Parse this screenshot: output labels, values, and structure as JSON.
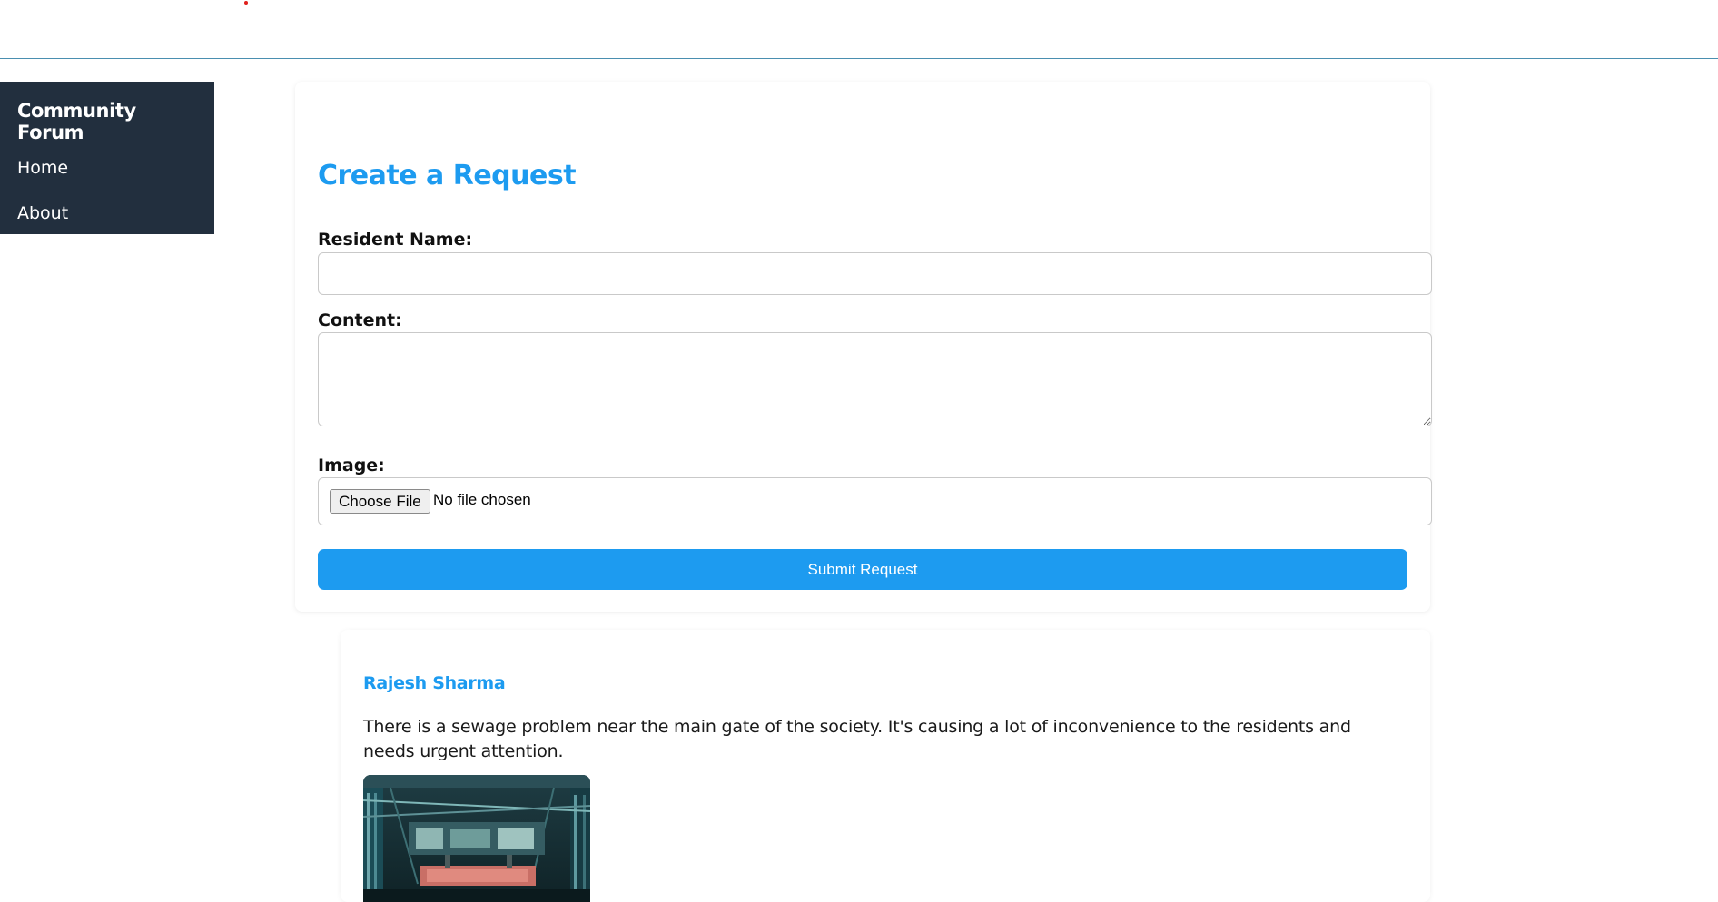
{
  "sidebar": {
    "title": "Community Forum",
    "items": [
      {
        "label": "Home"
      },
      {
        "label": "About"
      }
    ]
  },
  "form": {
    "title": "Create a Request",
    "resident_name_label": "Resident Name:",
    "resident_name_value": "",
    "content_label": "Content:",
    "content_value": "",
    "image_label": "Image:",
    "choose_file_label": "Choose File",
    "file_status": "No file chosen",
    "submit_label": "Submit Request"
  },
  "posts": [
    {
      "author": "Rajesh Sharma",
      "content": "There is a sewage problem near the main gate of the society. It's causing a lot of inconvenience to the residents and needs urgent attention."
    }
  ],
  "colors": {
    "accent": "#1d9bf0",
    "sidebar_bg": "#222f3e",
    "header_border": "#4a8fb0"
  }
}
